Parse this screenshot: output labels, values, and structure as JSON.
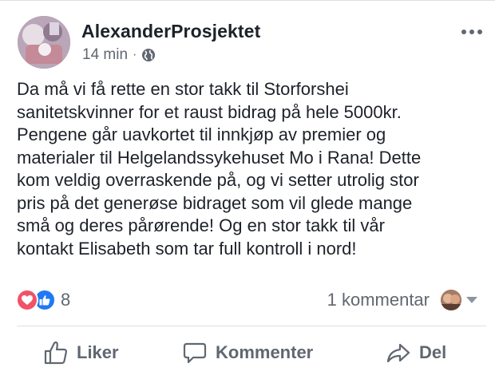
{
  "post": {
    "author": "AlexanderProsjektet",
    "time": "14 min",
    "separator": "·",
    "privacy_icon": "globe-icon",
    "text": "Da må vi få rette en stor takk til Storforshei\nsanitetskvinner for et raust bidrag på hele 5000kr.\nPengene går uavkortet til innkjøp av premier og\nmaterialer til Helgelandssykehuset Mo i Rana! Dette\nkom veldig overraskende på, og vi setter utrolig stor\npris på det generøse bidraget som vil glede mange\nsmå og deres pårørende! Og en stor takk til vår\nkontakt Elisabeth som tar full kontroll i nord!"
  },
  "reactions": {
    "icons": [
      "love-icon",
      "like-icon"
    ],
    "count": "8"
  },
  "comments": {
    "summary": "1 kommentar"
  },
  "actions": {
    "like_label": "Liker",
    "comment_label": "Kommenter",
    "share_label": "Del"
  },
  "colors": {
    "text": "#1d2129",
    "secondary": "#606770",
    "love": "#f25268",
    "like": "#2078f4",
    "divider": "#dddfe2"
  }
}
